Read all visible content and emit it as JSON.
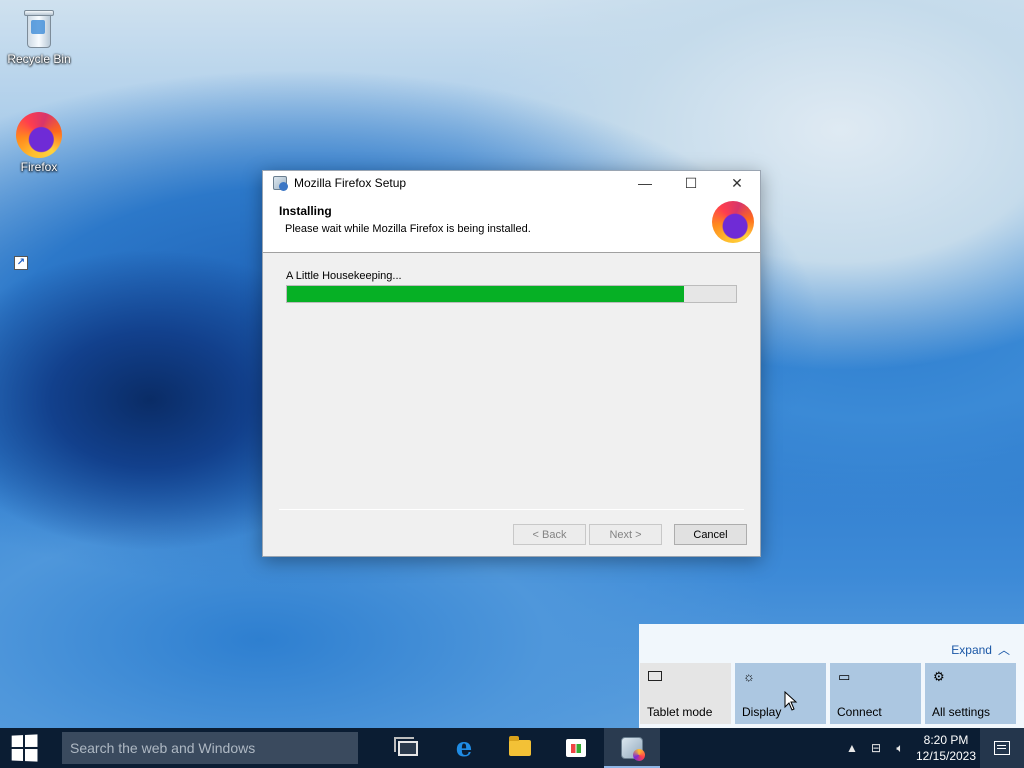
{
  "desktop": {
    "icons": [
      {
        "label": "Recycle Bin",
        "icon": "recycle-bin-icon"
      },
      {
        "label": "Firefox",
        "icon": "firefox-icon"
      }
    ]
  },
  "installer": {
    "title": "Mozilla Firefox Setup",
    "header_title": "Installing",
    "header_subtitle": "Please wait while Mozilla Firefox is being installed.",
    "status": "A Little Housekeeping...",
    "progress_fraction": 0.885,
    "buttons": {
      "back": "< Back",
      "next": "Next >",
      "cancel": "Cancel"
    },
    "window_controls": {
      "minimize": "—",
      "maximize": "☐",
      "close": "✕"
    }
  },
  "action_center": {
    "expand_label": "Expand",
    "tiles": [
      {
        "label": "Tablet mode",
        "icon": "tablet-mode-icon"
      },
      {
        "label": "Display",
        "icon": "display-brightness-icon"
      },
      {
        "label": "Connect",
        "icon": "connect-icon"
      },
      {
        "label": "All settings",
        "icon": "gear-icon"
      }
    ]
  },
  "taskbar": {
    "search_placeholder": "Search the web and Windows",
    "clock_time": "8:20 PM",
    "clock_date": "12/15/2023",
    "apps": [
      {
        "name": "Task View",
        "icon": "task-view-icon"
      },
      {
        "name": "Internet Explorer",
        "icon": "internet-explorer-icon"
      },
      {
        "name": "File Explorer",
        "icon": "file-explorer-icon"
      },
      {
        "name": "Store",
        "icon": "store-icon"
      },
      {
        "name": "Mozilla Firefox Setup",
        "icon": "firefox-setup-icon"
      }
    ]
  },
  "colors": {
    "progress_fill": "#06b025",
    "taskbar_bg": "#0b1d33",
    "link": "#1a57a6"
  }
}
